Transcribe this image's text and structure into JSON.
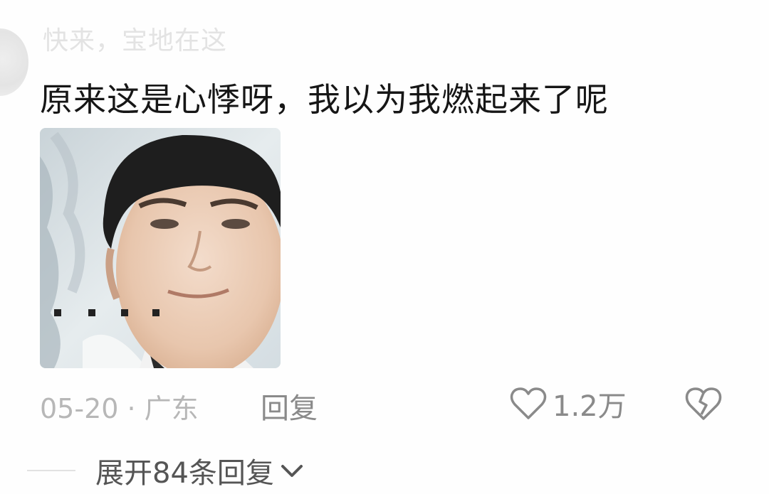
{
  "comment": {
    "username": "快来，宝地在这",
    "text": "原来这是心悸呀，我以为我燃起来了呢",
    "image": {
      "icon": "meme-photo",
      "caption": "。。。。"
    },
    "meta": {
      "date_location": "05-20 · 广东",
      "reply_label": "回复",
      "like_count": "1.2万"
    },
    "expand_replies_label": "展开84条回复"
  },
  "colors": {
    "text_primary": "#161616",
    "text_secondary": "#8a8a8a",
    "text_muted": "#b7b7b7",
    "username_faded": "#e3e3e3"
  }
}
